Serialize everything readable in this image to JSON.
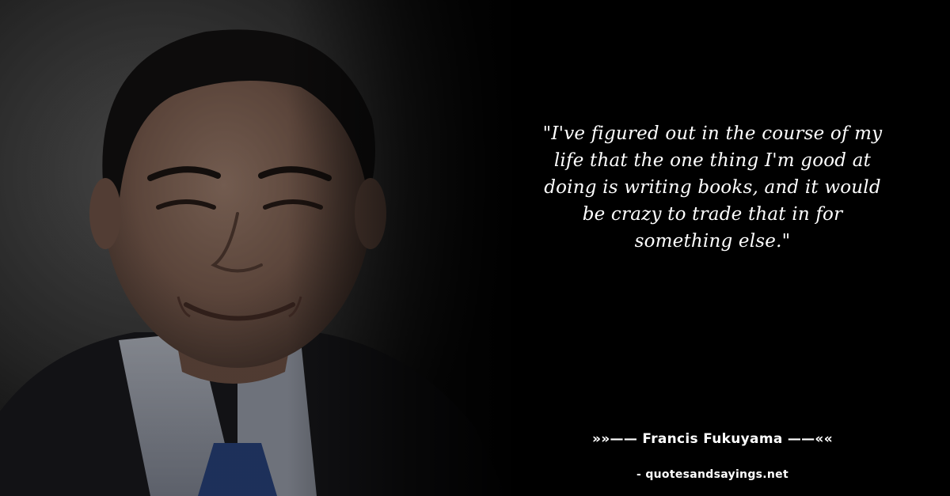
{
  "quote": {
    "line1": "\"I've figured out in the course of my",
    "line2": "life that the one thing I'm good at",
    "line3": "doing is writing books, and it would",
    "line4": "be crazy to trade that in for",
    "line5": "something else.\""
  },
  "attribution": {
    "author_line": "»»—— Francis Fukuyama ——««"
  },
  "source": {
    "site": "- quotesandsayings.net"
  },
  "colors": {
    "background": "#000000",
    "text": "#ffffff"
  }
}
